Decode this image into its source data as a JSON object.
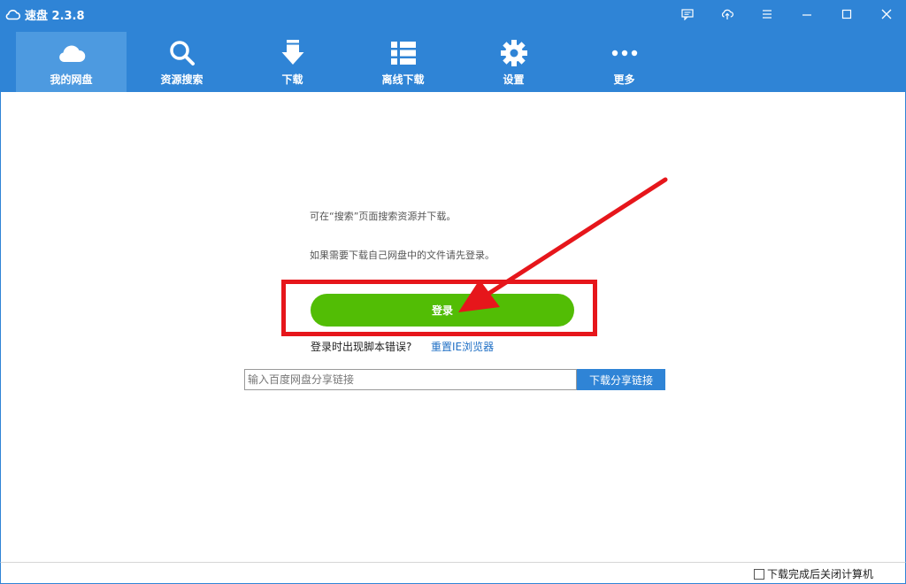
{
  "window": {
    "title": "速盘 2.3.8",
    "icons": [
      "cloud-logo-icon",
      "chat-icon",
      "cloud-upload-icon",
      "menu-icon",
      "minimize-icon",
      "maximize-icon",
      "close-icon"
    ]
  },
  "nav": {
    "items": [
      {
        "label": "我的网盘",
        "icon": "cloud-icon",
        "active": true
      },
      {
        "label": "资源搜索",
        "icon": "search-icon",
        "active": false
      },
      {
        "label": "下载",
        "icon": "download-icon",
        "active": false
      },
      {
        "label": "离线下载",
        "icon": "list-icon",
        "active": false
      },
      {
        "label": "设置",
        "icon": "gear-icon",
        "active": false
      },
      {
        "label": "更多",
        "icon": "more-icon",
        "active": false
      }
    ]
  },
  "main": {
    "hint_search": "可在“搜索”页面搜索资源并下载。",
    "hint_login": "如果需要下载自己网盘中的文件请先登录。",
    "login_label": "登录",
    "script_error_text": "登录时出现脚本错误?",
    "reset_ie_link": "重置IE浏览器",
    "share_input_placeholder": "输入百度网盘分享链接",
    "share_input_value": "",
    "download_share_label": "下载分享链接"
  },
  "annotation": {
    "color": "#e6161b",
    "shape": "arrow-and-highlight-box"
  },
  "status": {
    "shutdown_label": "下载完成后关闭计算机",
    "shutdown_checked": false
  },
  "colors": {
    "brand_blue": "#2f84d6",
    "active_tab": "#4d9ae0",
    "login_green": "#52bd05",
    "link_blue": "#1f6fc5"
  }
}
